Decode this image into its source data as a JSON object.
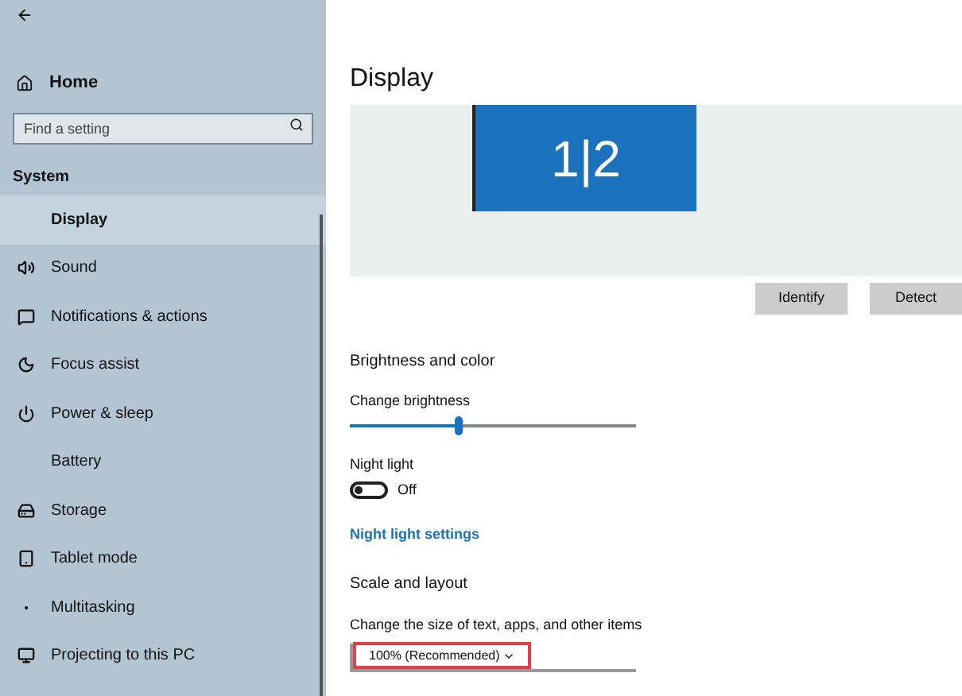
{
  "sidebar": {
    "home": "Home",
    "search": {
      "placeholder": "Find a setting"
    },
    "section": "System",
    "items": [
      {
        "label": "Display",
        "selected": true
      },
      {
        "label": "Sound",
        "selected": false
      },
      {
        "label": "Notifications & actions",
        "selected": false
      },
      {
        "label": "Focus assist",
        "selected": false
      },
      {
        "label": "Power & sleep",
        "selected": false
      },
      {
        "label": "Battery",
        "selected": false
      },
      {
        "label": "Storage",
        "selected": false
      },
      {
        "label": "Tablet mode",
        "selected": false
      },
      {
        "label": "Multitasking",
        "selected": false
      },
      {
        "label": "Projecting to this PC",
        "selected": false
      }
    ]
  },
  "main": {
    "title": "Display",
    "monitor_label": "1|2",
    "buttons": [
      "Identify",
      "Detect"
    ],
    "brightness": {
      "heading": "Brightness and color",
      "label": "Change brightness",
      "level": 0.38
    },
    "night_light": {
      "label": "Night light",
      "on": false,
      "state": "Off",
      "link": "Night light settings"
    },
    "scale": {
      "heading": "Scale and layout",
      "label": "Change the size of text, apps, and other items",
      "value": "100% (Recommended)",
      "highlighted": true
    }
  }
}
